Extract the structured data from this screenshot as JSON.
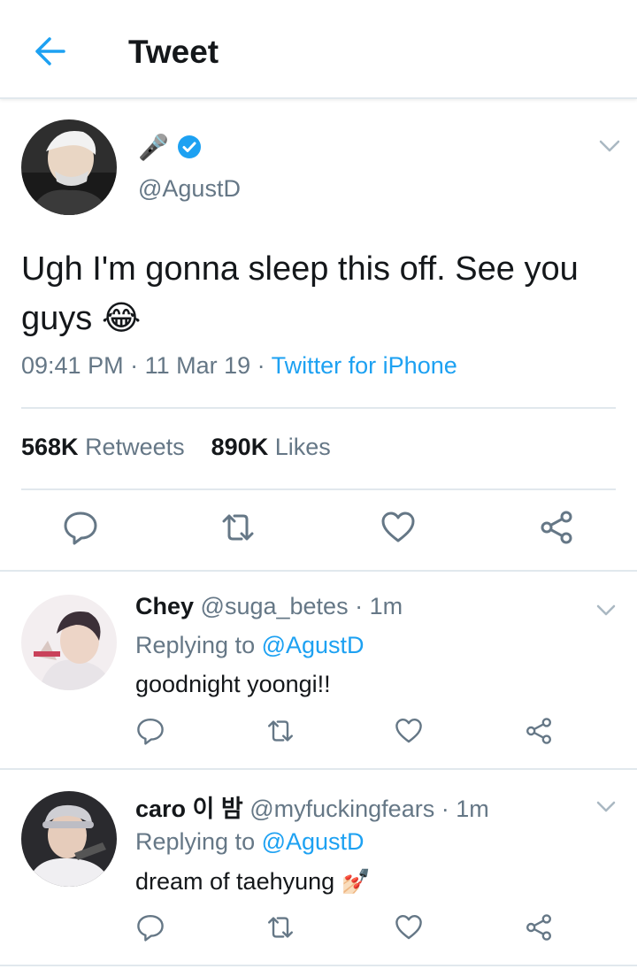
{
  "header": {
    "title": "Tweet",
    "back_icon": "arrow-left-icon"
  },
  "colors": {
    "accent": "#1da1f2",
    "muted": "#657786",
    "text": "#14171a",
    "divider": "#e1e8ed"
  },
  "tweet": {
    "display_name_emoji": "🎤",
    "verified_icon": "verified-badge-icon",
    "handle": "@AgustD",
    "text": "Ugh I'm gonna sleep this off. See you guys 😂",
    "time": "09:41 PM",
    "sep1": " · ",
    "date": "11 Mar 19",
    "sep2": " · ",
    "source": "Twitter for iPhone",
    "retweets_count": "568K",
    "retweets_label": "Retweets",
    "likes_count": "890K",
    "likes_label": "Likes"
  },
  "replies": [
    {
      "name": "Chey",
      "handle": "@suga_betes",
      "age": "· 1m",
      "replying_prefix": "Replying to",
      "replying_handle": "@AgustD",
      "text": "goodnight yoongi!!"
    },
    {
      "name": "caro 이 밤",
      "handle": "@myfuckingfears",
      "age": "· 1m",
      "replying_prefix": "Replying to",
      "replying_handle": "@AgustD",
      "text": "dream of taehyung 💅🏻"
    }
  ]
}
